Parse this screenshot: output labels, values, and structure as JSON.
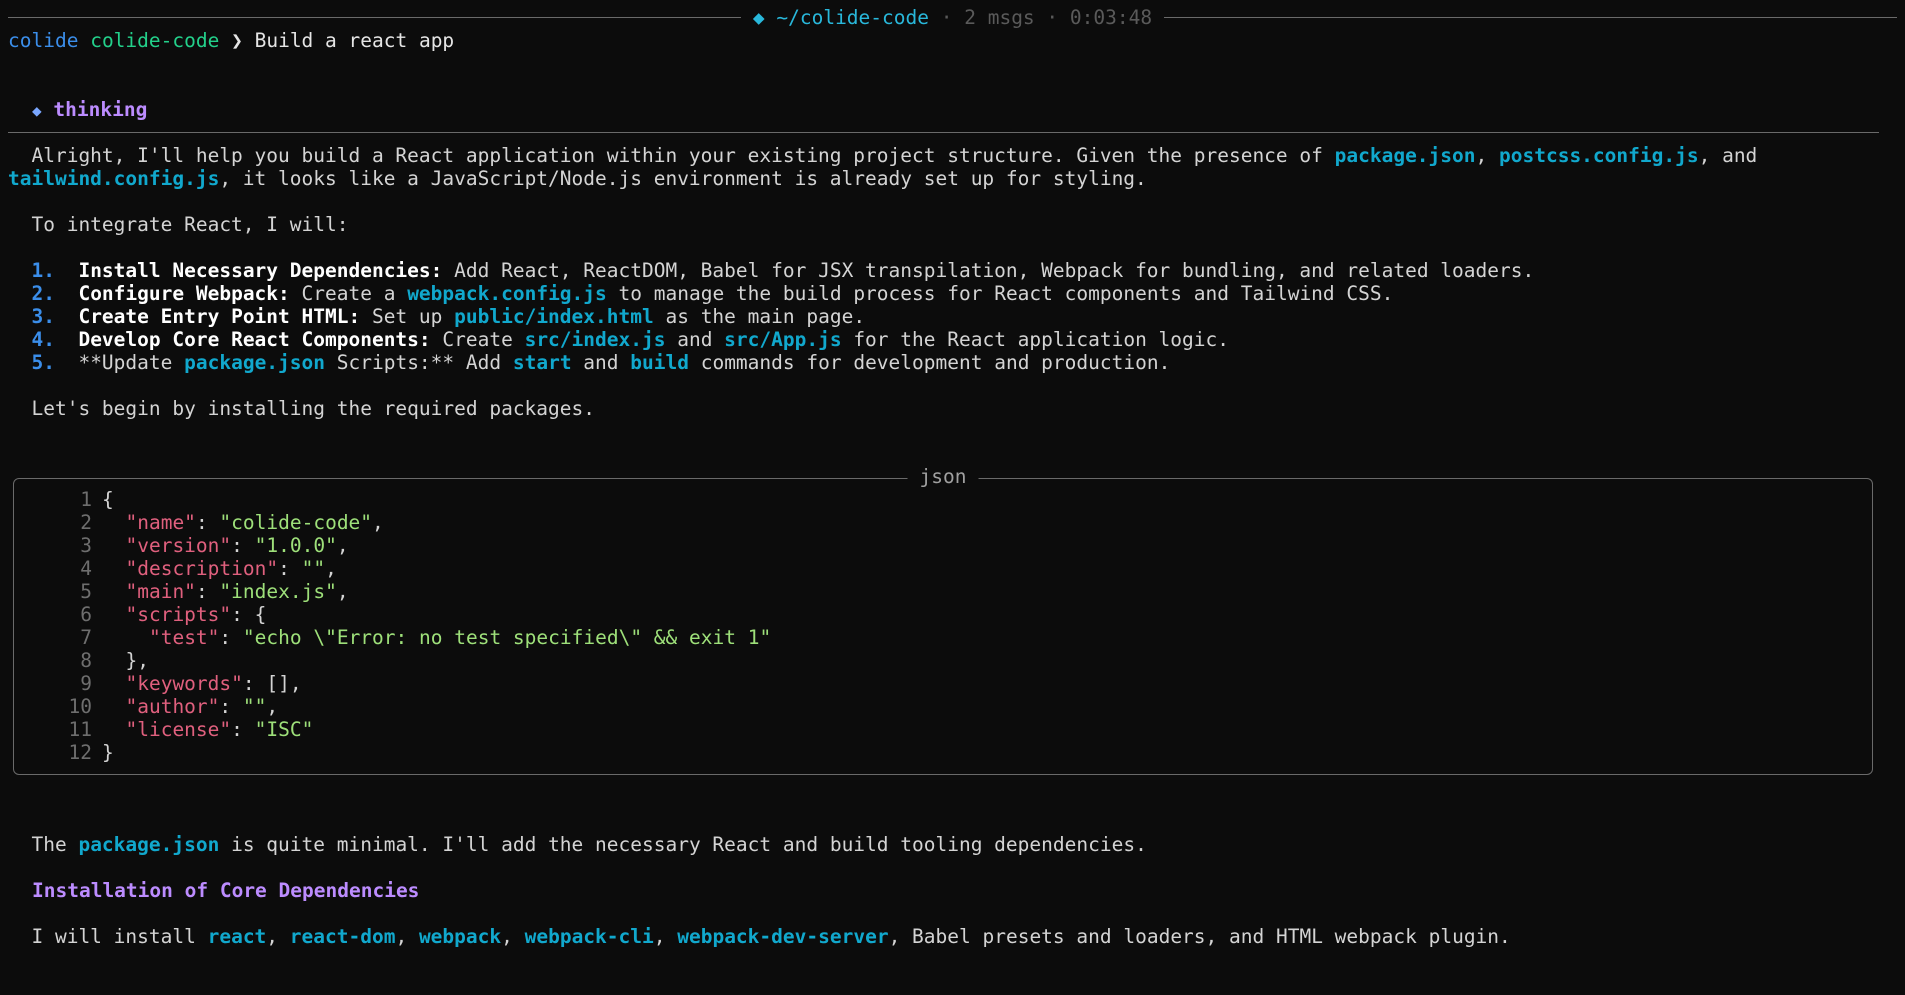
{
  "status_bar": {
    "path": "◆ ~/colide-code",
    "sep1": " · ",
    "msgs": "2 msgs",
    "sep2": " · ",
    "elapsed": "0:03:48"
  },
  "prompt": {
    "user": "colide",
    "project": "colide-code",
    "arrow": "❯",
    "command": "Build a react app"
  },
  "thinking": {
    "icon": "◆",
    "label": "thinking"
  },
  "intro": {
    "l1_a": "  Alright, I'll help you build a React application within your existing project structure. Given the presence of ",
    "l1_code1": "package.json",
    "l1_b": ", ",
    "l1_code2": "postcss.config.js",
    "l1_c": ", and",
    "l2_code": "tailwind.config.js",
    "l2_a": ", it looks like a JavaScript/Node.js environment is already set up for styling.",
    "l3": "  To integrate React, I will:"
  },
  "steps": [
    {
      "num": "1.",
      "title": "Install Necessary Dependencies:",
      "a": " Add React, ReactDOM, Babel for JSX transpilation, Webpack for bundling, and related loaders."
    },
    {
      "num": "2.",
      "title": "Configure Webpack:",
      "a": " Create a ",
      "code": "webpack.config.js",
      "b": " to manage the build process for React components and Tailwind CSS."
    },
    {
      "num": "3.",
      "title": "Create Entry Point HTML:",
      "a": " Set up ",
      "code": "public/index.html",
      "b": " as the main page."
    },
    {
      "num": "4.",
      "title": "Develop Core React Components:",
      "a": " Create ",
      "code": "src/index.js",
      "b": " and ",
      "code2": "src/App.js",
      "c": " for the React application logic."
    },
    {
      "num": "5.",
      "a": "**Update ",
      "code": "package.json",
      "b": " Scripts:** Add ",
      "code2": "start",
      "c": " and ",
      "code3": "build",
      "d": " commands for development and production."
    }
  ],
  "begin": "  Let's begin by installing the required packages.",
  "code_panel": {
    "title": "json",
    "lines": [
      {
        "n": "1",
        "t": "{"
      },
      {
        "n": "2",
        "k": "\"name\"",
        "v": "\"colide-code\"",
        "e": ","
      },
      {
        "n": "3",
        "k": "\"version\"",
        "v": "\"1.0.0\"",
        "e": ","
      },
      {
        "n": "4",
        "k": "\"description\"",
        "v": "\"\"",
        "e": ","
      },
      {
        "n": "5",
        "k": "\"main\"",
        "v": "\"index.js\"",
        "e": ","
      },
      {
        "n": "6",
        "k": "\"scripts\"",
        "e": ": {"
      },
      {
        "n": "7",
        "k": "\"test\"",
        "v": "\"echo \\\"Error: no test specified\\\" && exit 1\"",
        "e": ""
      },
      {
        "n": "8",
        "t": "  },"
      },
      {
        "n": "9",
        "k": "\"keywords\"",
        "e": ": [],"
      },
      {
        "n": "10",
        "k": "\"author\"",
        "v": "\"\"",
        "e": ","
      },
      {
        "n": "11",
        "k": "\"license\"",
        "v": "\"ISC\"",
        "e": ""
      },
      {
        "n": "12",
        "t": "}"
      }
    ]
  },
  "after": {
    "l1_a": "  The ",
    "l1_code": "package.json",
    "l1_b": " is quite minimal. I'll add the necessary React and build tooling dependencies.",
    "heading": "Installation of Core Dependencies",
    "l3_a": "  I will install ",
    "pkgs": [
      "react",
      "react-dom",
      "webpack",
      "webpack-cli",
      "webpack-dev-server"
    ],
    "sep": ", ",
    "l3_b": ", Babel presets and loaders, and HTML webpack plugin."
  }
}
